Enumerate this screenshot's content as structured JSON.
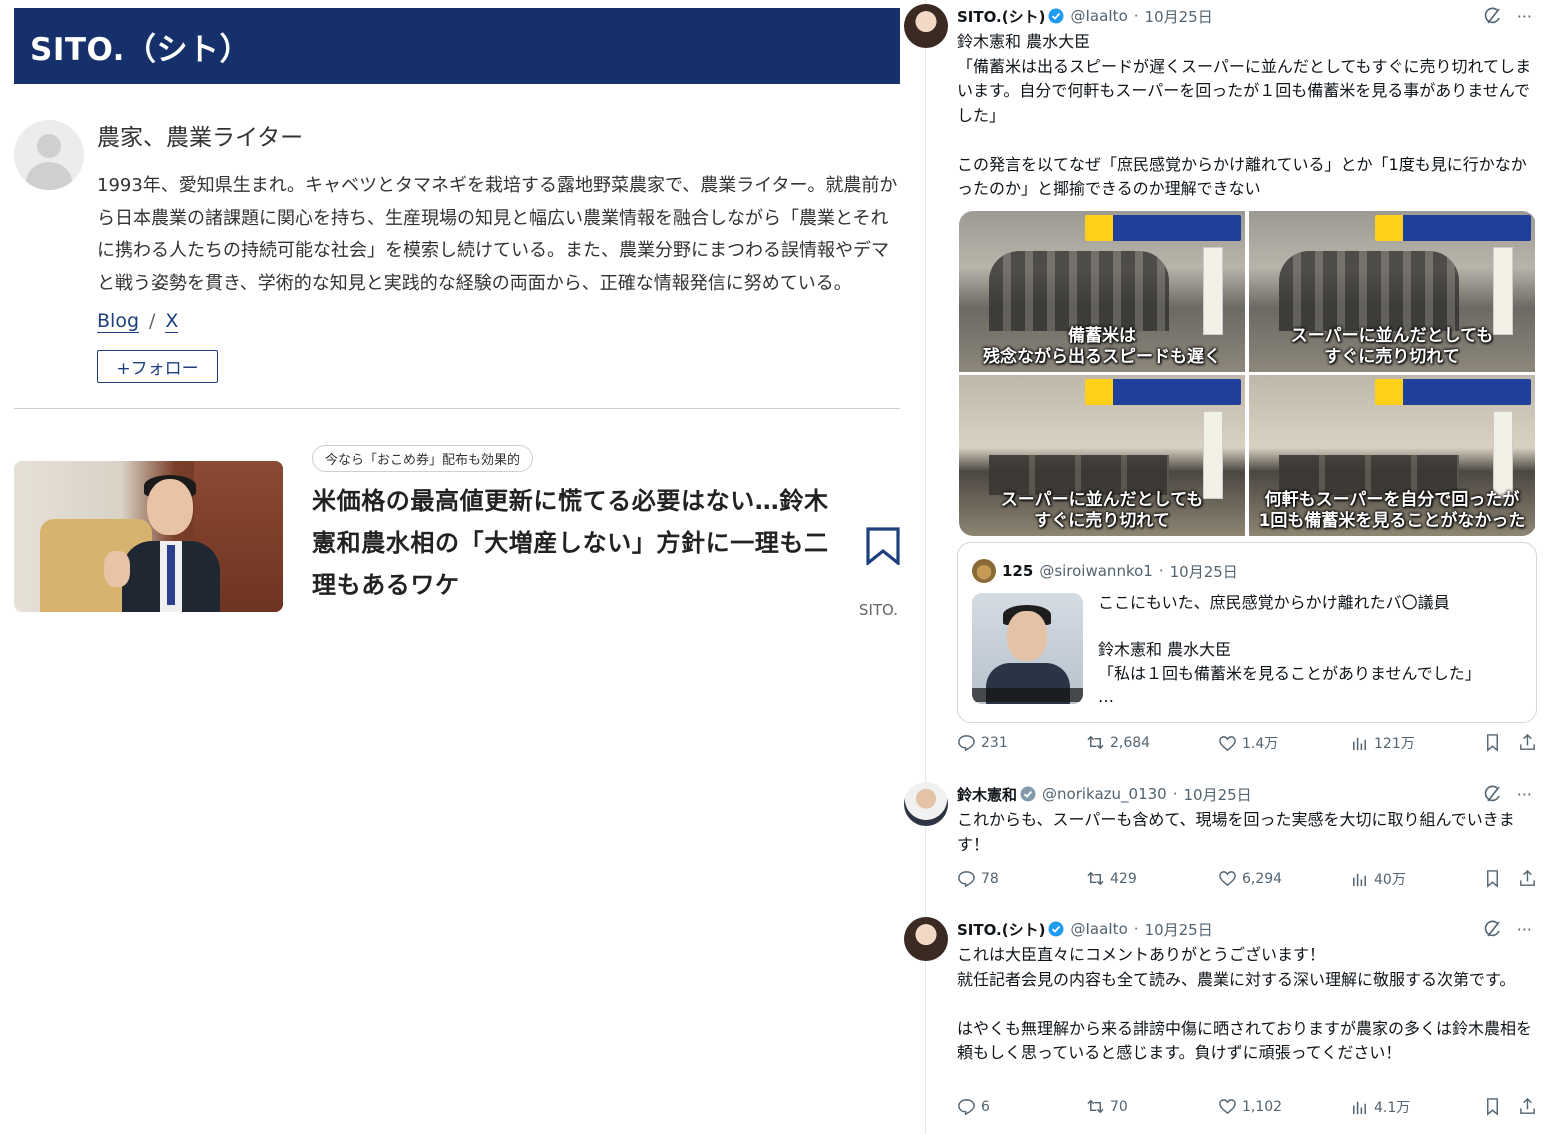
{
  "left": {
    "header_title": "SITO.（シト）",
    "author": {
      "role": "農家、農業ライター",
      "bio": "1993年、愛知県生まれ。キャベツとタマネギを栽培する露地野菜農家で、農業ライター。就農前から日本農業の諸課題に関心を持ち、生産現場の知見と幅広い農業情報を融合しながら「農業とそれに携わる人たちの持続可能な社会」を模索し続けている。また、農業分野にまつわる誤情報やデマと戦う姿勢を貫き、学術的な知見と実践的な経験の両面から、正確な情報発信に努めている。",
      "links": [
        "Blog",
        "X"
      ],
      "link_separator": "/",
      "follow_label": "+フォロー"
    },
    "article": {
      "tag": "今なら「おこめ券」配布も効果的",
      "title": "米価格の最高値更新に慌てる必要はない…鈴木憲和農水相の「大増産しない」方針に一理も二理もあるワケ",
      "author": "SITO."
    }
  },
  "tweets": [
    {
      "name": "SITO.(シト)",
      "handle": "@IaaIto",
      "date": "10月25日",
      "text": "鈴木憲和 農水大臣\n「備蓄米は出るスピードが遅くスーパーに並んだとしてもすぐに売り切れてしまいます。自分で何軒もスーパーを回ったが１回も備蓄米を見る事がありませんでした」\n\nこの発言を以てなぜ「庶民感覚からかけ離れている」とか「1度も見に行かなかったのか」と揶揄できるのか理解できない",
      "media_captions": [
        "備蓄米は\n残念ながら出るスピードも遅く",
        "スーパーに並んだとしても\nすぐに売り切れて",
        "スーパーに並んだとしても\nすぐに売り切れて",
        "何軒もスーパーを自分で回ったが\n1回も備蓄米を見ることがなかった"
      ],
      "quote": {
        "name": "125",
        "handle": "@siroiwannko1",
        "date": "10月25日",
        "text": "ここにもいた、庶民感覚からかけ離れたバ〇議員\n\n鈴木憲和 農水大臣\n「私は１回も備蓄米を見ることがありませんでした」\n…"
      },
      "stats": {
        "replies": "231",
        "reposts": "2,684",
        "likes": "1.4万",
        "views": "121万"
      }
    },
    {
      "name": "鈴木憲和",
      "handle": "@norikazu_0130",
      "date": "10月25日",
      "text": "これからも、スーパーも含めて、現場を回った実感を大切に取り組んでいきます！",
      "stats": {
        "replies": "78",
        "reposts": "429",
        "likes": "6,294",
        "views": "40万"
      }
    },
    {
      "name": "SITO.(シト)",
      "handle": "@IaaIto",
      "date": "10月25日",
      "text": "これは大臣直々にコメントありがとうございます！\n就任記者会見の内容も全て読み、農業に対する深い理解に敬服する次第です。\n\nはやくも無理解から来る誹謗中傷に晒されておりますが農家の多くは鈴木農相を頼もしく思っていると感じます。負けずに頑張ってください！",
      "stats": {
        "replies": "6",
        "reposts": "70",
        "likes": "1,102",
        "views": "4.1万"
      }
    }
  ],
  "colors": {
    "header_bg": "#16306b",
    "link": "#1d3f7d",
    "verified": "#1d9bf0",
    "muted": "#536471"
  },
  "icons": [
    "avatar-placeholder-icon",
    "bookmark-icon",
    "verified-icon",
    "grok-icon",
    "more-icon",
    "reply-icon",
    "repost-icon",
    "like-icon",
    "views-icon",
    "share-icon"
  ]
}
